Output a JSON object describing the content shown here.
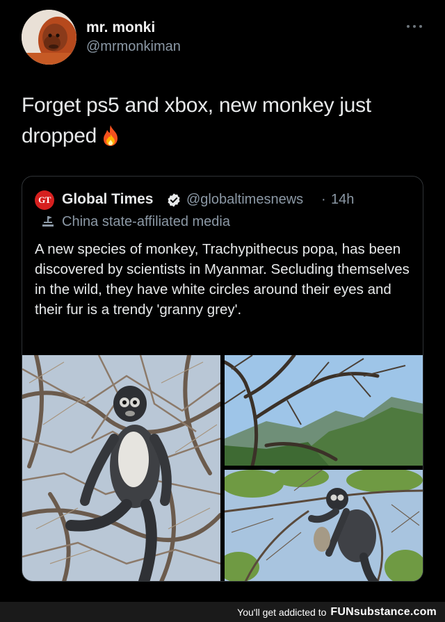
{
  "author": {
    "name": "mr. monki",
    "handle": "@mrmonkiman",
    "avatar_icon": "orangutan-avatar"
  },
  "tweet": {
    "text": "Forget ps5 and xbox, new monkey just dropped",
    "emoji_icon": "fire-icon"
  },
  "quote": {
    "logo_text": "GT",
    "name": "Global Times",
    "handle": "@globaltimesnews",
    "separator": "·",
    "time": "14h",
    "state_label": "China state-affiliated media",
    "text": "A new species of monkey, Trachypithecus popa, has been discovered by scientists in Myanmar. Secluding themselves in the wild, they have white circles around their eyes and their fur is a trendy 'granny grey'.",
    "media": [
      {
        "name": "monkey-sitting-in-tree"
      },
      {
        "name": "mountain-forest-landscape"
      },
      {
        "name": "monkey-in-branches"
      }
    ]
  },
  "footer": {
    "text": "You'll get addicted to",
    "brand": "FUNsubstance.com"
  },
  "colors": {
    "background": "#000000",
    "verified": "#1d9bf0",
    "gt_red": "#d6201f",
    "muted": "#8b98a5"
  }
}
